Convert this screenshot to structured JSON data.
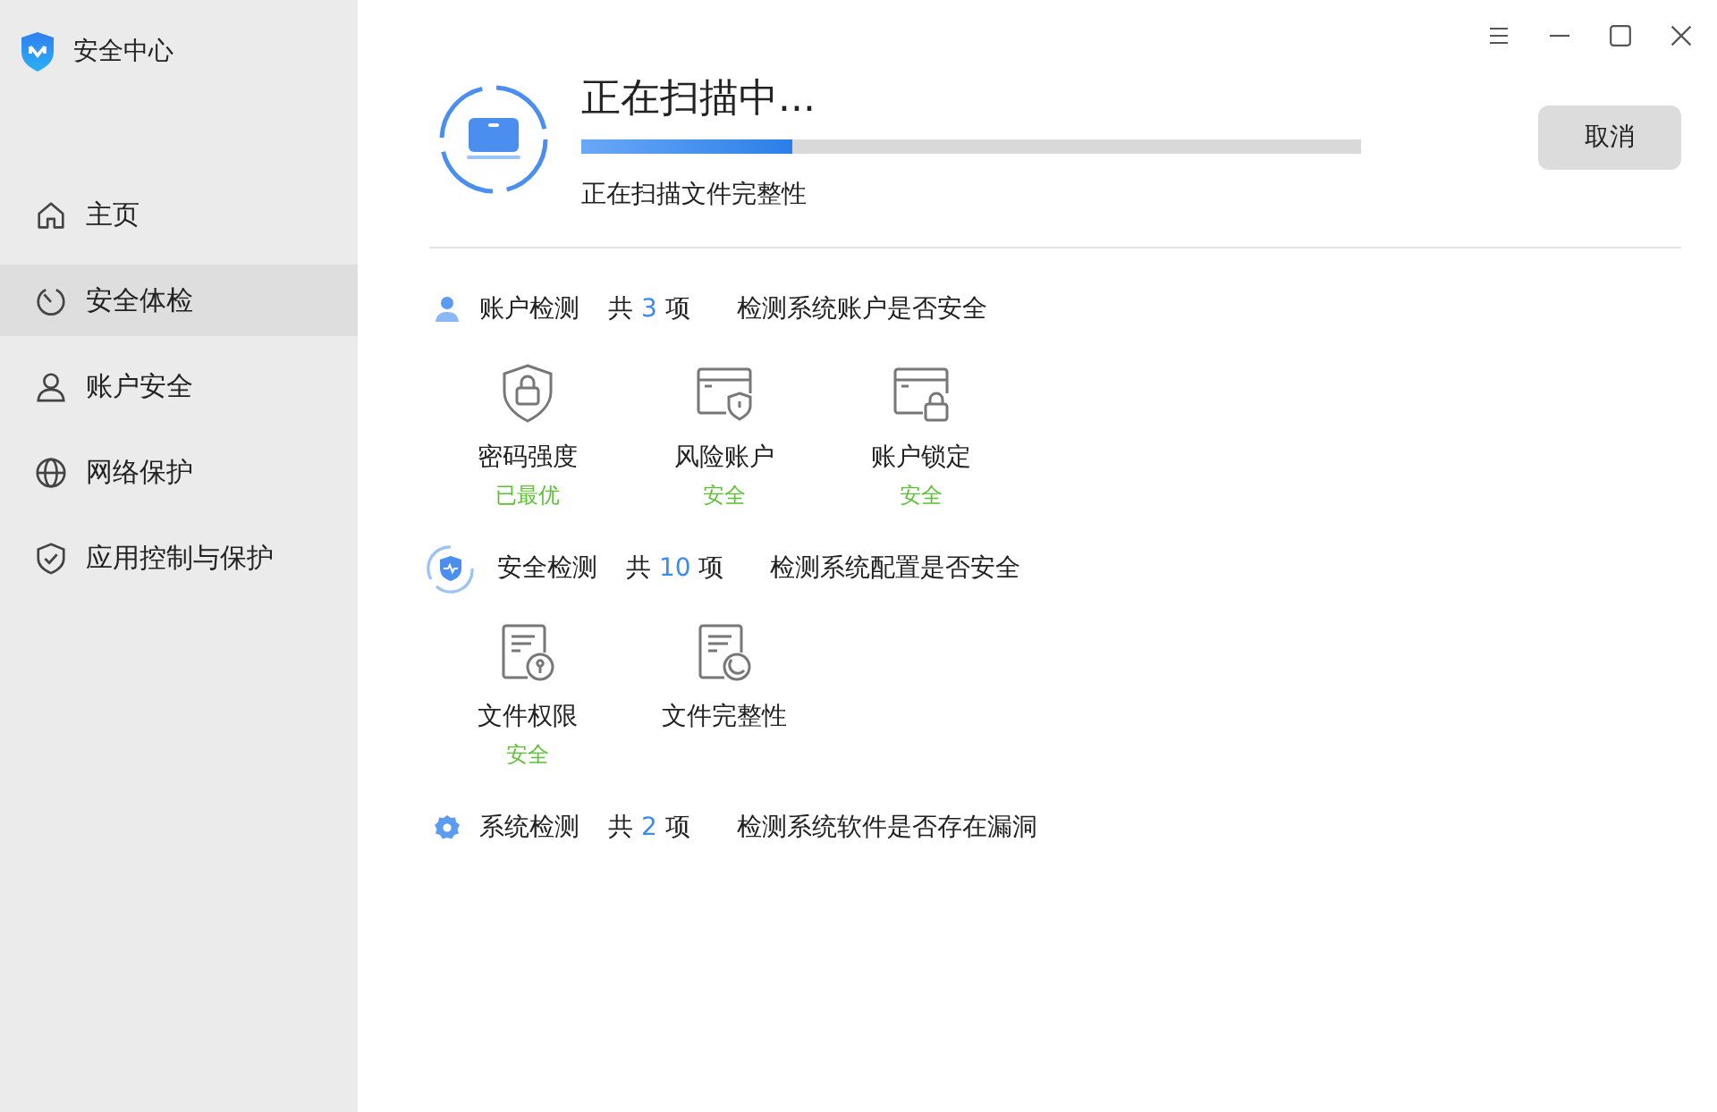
{
  "app": {
    "title": "安全中心"
  },
  "sidebar": {
    "items": [
      {
        "label": "主页",
        "kind": "home",
        "selected": false
      },
      {
        "label": "安全体检",
        "kind": "timer",
        "selected": true
      },
      {
        "label": "账户安全",
        "kind": "person",
        "selected": false
      },
      {
        "label": "网络保护",
        "kind": "globe",
        "selected": false
      },
      {
        "label": "应用控制与保护",
        "kind": "shield",
        "selected": false
      }
    ]
  },
  "window_controls": [
    {
      "kind": "menu"
    },
    {
      "kind": "minimize"
    },
    {
      "kind": "maximize"
    },
    {
      "kind": "close"
    }
  ],
  "scan": {
    "title": "正在扫描中...",
    "level": 0.27,
    "status": "正在扫描文件完整性",
    "cancel_button": "取消"
  },
  "sections": [
    {
      "kind": "person",
      "title": "账户检测",
      "count_prefix": "共",
      "count": "3",
      "count_suffix": "项",
      "description": "检测系统账户是否安全",
      "items": [
        {
          "kind": "shield-lock",
          "label": "密码强度",
          "status": "已最优"
        },
        {
          "kind": "card-shield",
          "label": "风险账户",
          "status": "安全"
        },
        {
          "kind": "card-lock",
          "label": "账户锁定",
          "status": "安全"
        }
      ]
    },
    {
      "kind": "scanning",
      "title": "安全检测",
      "count_prefix": "共",
      "count": "10",
      "count_suffix": "项",
      "description": "检测系统配置是否安全",
      "items": [
        {
          "kind": "doc-lock",
          "label": "文件权限",
          "status": "安全"
        },
        {
          "kind": "doc-clock",
          "label": "文件完整性"
        }
      ]
    },
    {
      "kind": "gear",
      "title": "系统检测",
      "count_prefix": "共",
      "count": "2",
      "count_suffix": "项",
      "description": "检测系统软件是否存在漏洞"
    }
  ]
}
